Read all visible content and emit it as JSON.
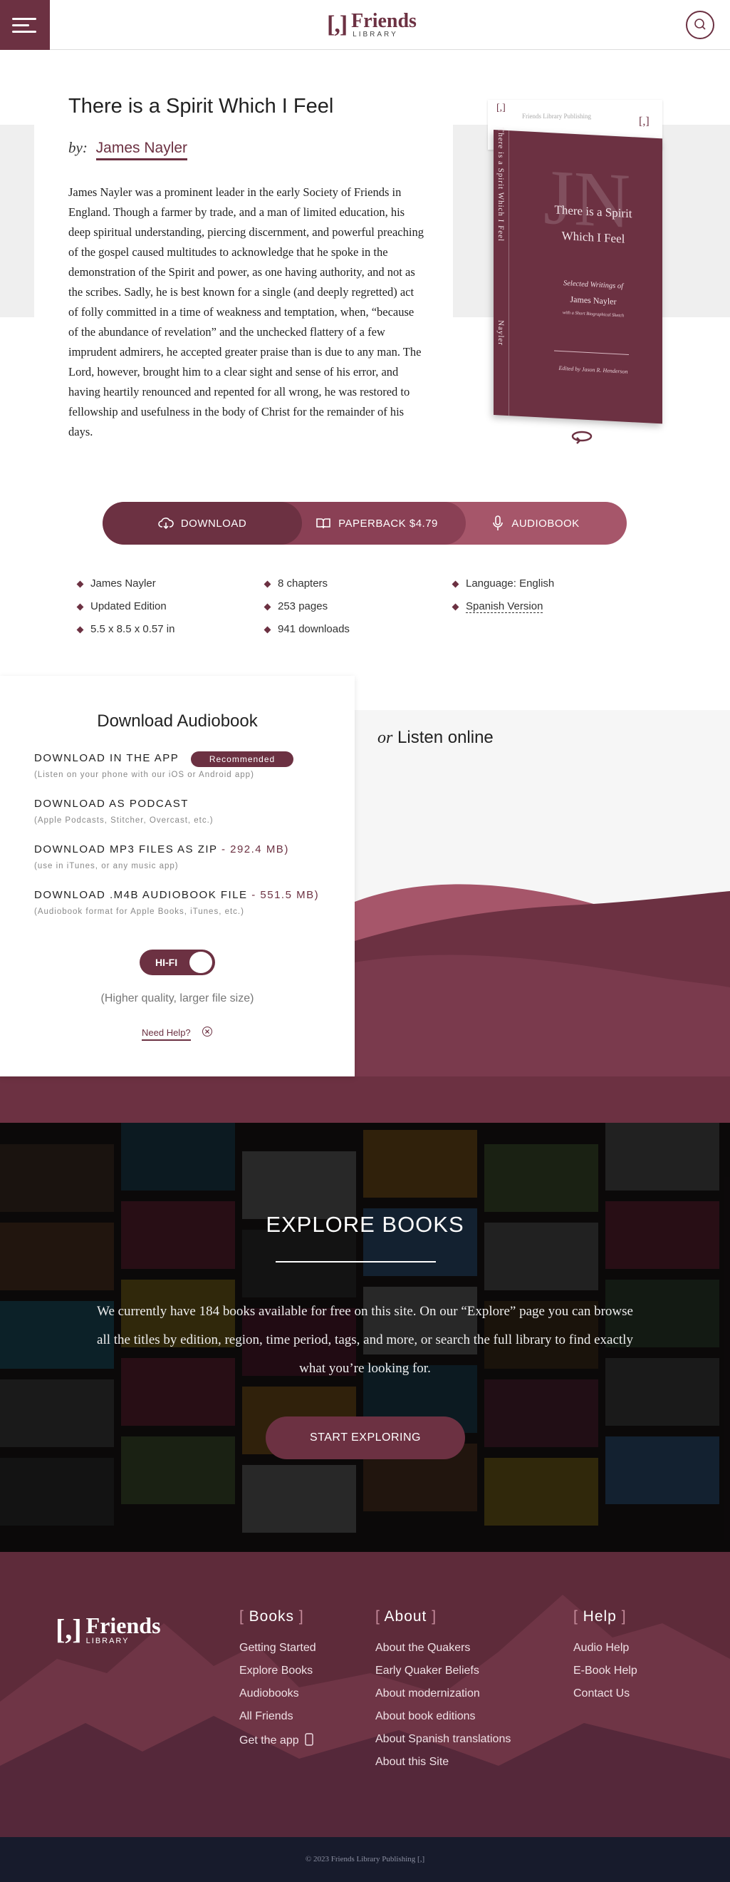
{
  "header": {
    "logo_bracket": "[,]",
    "logo_name": "Friends",
    "logo_sub": "LIBRARY"
  },
  "book": {
    "title": "There is a Spirit Which I Feel",
    "by_label": "by:",
    "author": "James Nayler",
    "description": "James Nayler was a prominent leader in the early Society of Friends in England. Though a farmer by trade, and a man of limited education, his deep spiritual understanding, piercing discernment, and powerful preaching of the gospel caused multitudes to acknowledge that he spoke in the demonstration of the Spirit and power, as one having authority, and not as the scribes. Sadly, he is best known for a single (and deeply regretted) act of folly committed in a time of weakness and temptation, when, “because of the abundance of revelation” and the unchecked flattery of a few imprudent admirers, he accepted greater praise than is due to any man. The Lord, however, brought him to a clear sight and sense of his error, and having heartily renounced and repented for all wrong, he was restored to fellowship and usefulness in the body of Christ for the remainder of his days."
  },
  "cover": {
    "publisher": "Friends Library Publishing",
    "bracket": "[,]",
    "initials": "JN",
    "title_line1": "There is a Spirit",
    "title_line2": "Which I Feel",
    "subtitle": "Selected Writings of",
    "author": "James Nayler",
    "subnote": "with a Short Biographical Sketch",
    "editor": "Edited by Jason R. Henderson",
    "spine_title": "There is a Spirit Which I Feel",
    "spine_author": "Nayler"
  },
  "actions": {
    "download": "DOWNLOAD",
    "paperback": "PAPERBACK $4.79",
    "audiobook": "AUDIOBOOK"
  },
  "meta": {
    "col1": [
      "James Nayler",
      "Updated Edition",
      "5.5 x 8.5 x 0.57 in"
    ],
    "col2": [
      "8 chapters",
      "253 pages",
      "941 downloads"
    ],
    "col3": [
      "Language: English",
      "Spanish Version"
    ]
  },
  "audio": {
    "heading": "Download Audiobook",
    "options": [
      {
        "label": "DOWNLOAD IN THE APP",
        "size": "",
        "note": "(Listen on your phone with our iOS or Android app)"
      },
      {
        "label": "DOWNLOAD AS PODCAST",
        "size": "",
        "note": "(Apple Podcasts, Stitcher, Overcast, etc.)"
      },
      {
        "label": "DOWNLOAD MP3 FILES AS ZIP",
        "size": " - 292.4 MB)",
        "note": "(use in iTunes, or any music app)"
      },
      {
        "label": "DOWNLOAD .M4B AUDIOBOOK FILE",
        "size": " - 551.5 MB)",
        "note": "(Audiobook format for Apple Books, iTunes, etc.)"
      }
    ],
    "recommended": "Recommended",
    "hifi": "HI-FI",
    "hifi_note": "(Higher quality, larger file size)",
    "need_help": "Need Help?",
    "listen_or": "or",
    "listen_title": "Listen online",
    "colors": {
      "accent": "#6c3142",
      "wave_light": "#a6566a",
      "wave_dark": "#5e2b3a"
    }
  },
  "explore": {
    "title": "EXPLORE BOOKS",
    "text": "We currently have 184 books available for free on this site. On our “Explore” page you can browse all the titles by edition, region, time period, tags, and more, or search the full library to find exactly what you’re looking for.",
    "button": "START EXPLORING"
  },
  "footer": {
    "logo_bracket": "[,]",
    "logo_name": "Friends",
    "logo_sub": "LIBRARY",
    "books": {
      "heading": "Books",
      "links": [
        "Getting Started",
        "Explore Books",
        "Audiobooks",
        "All Friends",
        "Get the app"
      ]
    },
    "about": {
      "heading": "About",
      "links": [
        "About the Quakers",
        "Early Quaker Beliefs",
        "About modernization",
        "About book editions",
        "About Spanish translations",
        "About this Site"
      ]
    },
    "help": {
      "heading": "Help",
      "links": [
        "Audio Help",
        "E-Book Help",
        "Contact Us"
      ]
    },
    "copyright": "© 2023 Friends Library Publishing [,]"
  }
}
